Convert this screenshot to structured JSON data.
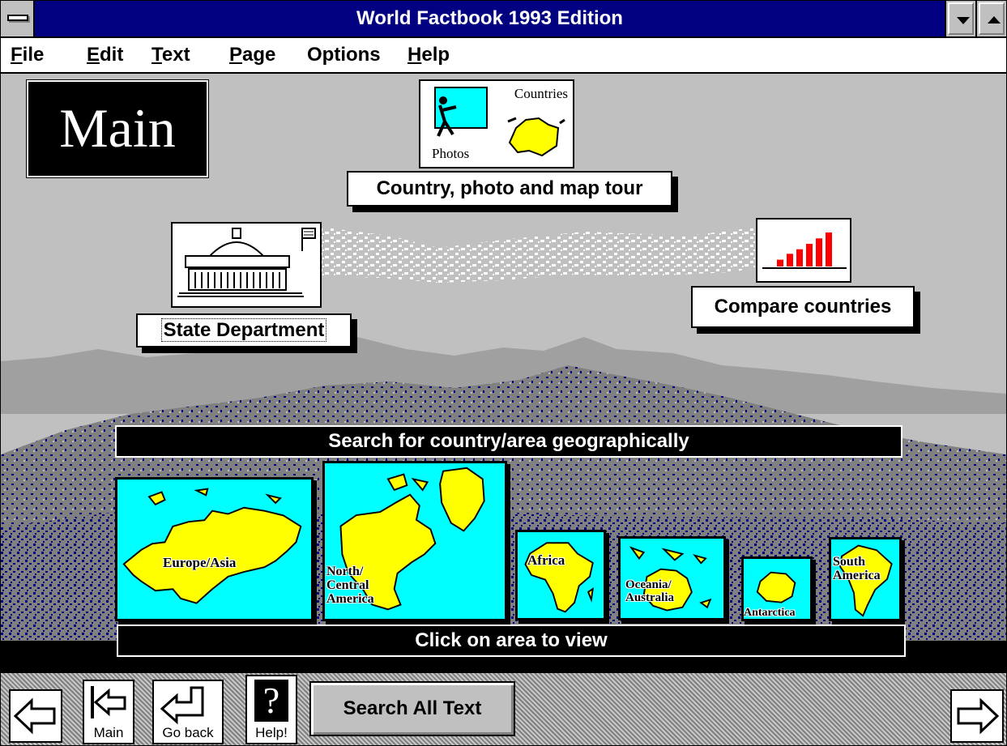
{
  "window": {
    "title": "World Factbook 1993 Edition"
  },
  "menu": {
    "items": [
      {
        "key": "F",
        "rest": "ile"
      },
      {
        "key": "E",
        "rest": "dit"
      },
      {
        "key": "T",
        "rest": "ext"
      },
      {
        "key": "P",
        "rest": "age"
      },
      {
        "key": "",
        "rest": "Options"
      },
      {
        "key": "H",
        "rest": "elp"
      }
    ]
  },
  "main": {
    "heading": "Main",
    "tour": {
      "photos_label": "Photos",
      "countries_label": "Countries",
      "button_label": "Country, photo and map tour"
    },
    "state_dept": {
      "button_label": "State Department"
    },
    "compare": {
      "button_label": "Compare countries",
      "bar_levels": [
        0.15,
        0.28,
        0.38,
        0.5,
        0.62,
        0.75
      ]
    },
    "geo_search_label": "Search for country/area geographically",
    "click_hint": "Click on area to view",
    "regions": [
      {
        "label": "Europe/Asia"
      },
      {
        "label": "North/\nCentral\nAmerica"
      },
      {
        "label": "Africa"
      },
      {
        "label": "Oceania/\nAustralia"
      },
      {
        "label": "Antarctica"
      },
      {
        "label": "South\nAmerica"
      }
    ]
  },
  "toolbar": {
    "main_caption": "Main",
    "goback_caption": "Go back",
    "help_caption": "Help!",
    "help_glyph": "?",
    "search_label": "Search All Text"
  },
  "colors": {
    "title_bar": "#000080",
    "map_water": "#00ffff",
    "map_land": "#ffff00",
    "chart_bars": "#ff0000",
    "background": "#c0c0c0"
  }
}
